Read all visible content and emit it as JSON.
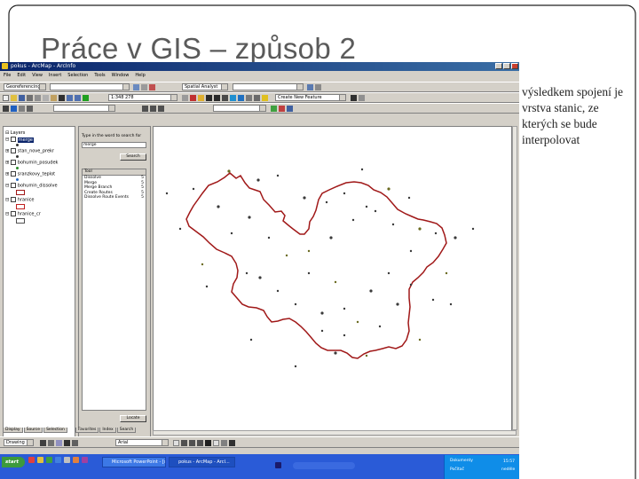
{
  "slide": {
    "title": "Práce v GIS – způsob 2",
    "body": "výsledkem spojení je vrstva stanic, ze kterých se bude interpolovat"
  },
  "app": {
    "window_title": "pokus - ArcMap - ArcInfo",
    "menu": [
      "File",
      "Edit",
      "View",
      "Insert",
      "Selection",
      "Tools",
      "Window",
      "Help"
    ],
    "editor_label": "Georeferencing",
    "scale": "1:348 278",
    "spatial_analyst_label": "Spatial Analyst",
    "layer_combo": "Create New Feature",
    "toc": {
      "root": "Layers",
      "layers": [
        {
          "name": "merge",
          "checked": true,
          "selected": true
        },
        {
          "name": "stan_nove_prekr",
          "checked": false,
          "selected": false
        },
        {
          "name": "bohumin_posudek",
          "checked": false,
          "selected": false
        },
        {
          "name": "sranzkovy_teplot",
          "checked": false,
          "selected": false
        },
        {
          "name": "bohumin_dissolve",
          "checked": true,
          "selected": false
        },
        {
          "name": "hranice",
          "checked": true,
          "selected": false
        },
        {
          "name": "hranice_cr",
          "checked": true,
          "selected": false
        }
      ],
      "tabs": [
        "Display",
        "Source",
        "Selection"
      ]
    },
    "search": {
      "prompt": "Type in the word to search for",
      "input_value": "merge",
      "search_button": "Search",
      "results_header": "Tool",
      "results": [
        {
          "name": "Dissolve",
          "value": "5"
        },
        {
          "name": "Merge",
          "value": "5"
        },
        {
          "name": "Merge Branch",
          "value": "5"
        },
        {
          "name": "Create Routes",
          "value": "5"
        },
        {
          "name": "Dissolve Route Events",
          "value": "5"
        }
      ],
      "locate_button": "Locate",
      "tabs": [
        "Favorites",
        "Index",
        "Search"
      ]
    },
    "drawing": {
      "drawing_label": "Drawing",
      "font": "Arial"
    },
    "taskbar": {
      "start_label": "start",
      "tasks": [
        "Microsoft PowerPoint - [se...",
        "pokus - ArcMap - ArcI..."
      ],
      "tray_items": [
        "Dokumenty",
        "Počítač"
      ],
      "clock": "15:57",
      "day": "neděle"
    }
  },
  "colors": {
    "boundary": "#a01818",
    "station_dot": "#3a3a3a",
    "selection": "#0a246a",
    "taskbar": "#2a5bd7"
  }
}
